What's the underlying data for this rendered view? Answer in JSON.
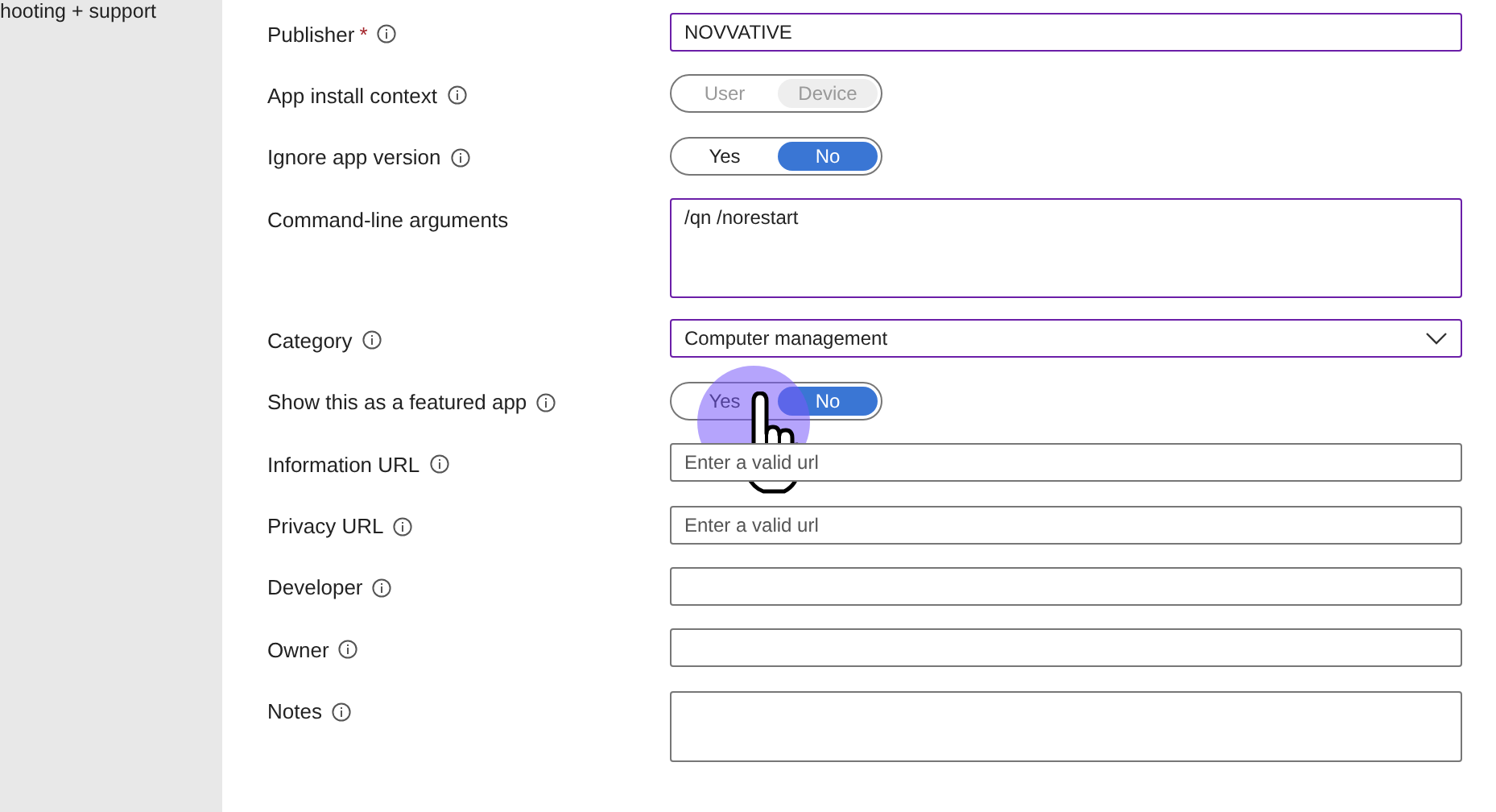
{
  "sidebar": {
    "items": [
      {
        "label": "hooting + support"
      }
    ]
  },
  "fields": [
    {
      "kind": "text",
      "label": "Publisher",
      "required_mark": "*",
      "info": true,
      "value": "NOVVATIVE",
      "focused": true
    },
    {
      "kind": "toggle",
      "label": "App install context",
      "info": true,
      "disabled": true,
      "options": [
        {
          "label": "User",
          "selected": false
        },
        {
          "label": "Device",
          "selected": true
        }
      ]
    },
    {
      "kind": "toggle",
      "label": "Ignore app version",
      "info": true,
      "disabled": false,
      "options": [
        {
          "label": "Yes",
          "selected": false
        },
        {
          "label": "No",
          "selected": true
        }
      ]
    },
    {
      "kind": "textarea",
      "label": "Command-line arguments",
      "info": false,
      "value": "/qn /norestart",
      "focused": true
    },
    {
      "kind": "dropdown",
      "label": "Category",
      "info": true,
      "value": "Computer management",
      "focused": true
    },
    {
      "kind": "toggle",
      "label": "Show this as a featured app",
      "info": true,
      "disabled": false,
      "pressed": true,
      "options": [
        {
          "label": "Yes",
          "selected": false
        },
        {
          "label": "No",
          "selected": true
        }
      ]
    },
    {
      "kind": "text",
      "label": "Information URL",
      "info": true,
      "placeholder": "Enter a valid url",
      "focused": false
    },
    {
      "kind": "text",
      "label": "Privacy URL",
      "info": true,
      "placeholder": "Enter a valid url",
      "focused": false
    },
    {
      "kind": "text",
      "label": "Developer",
      "info": true,
      "focused": false
    },
    {
      "kind": "text",
      "label": "Owner",
      "info": true,
      "focused": false
    },
    {
      "kind": "textarea",
      "label": "Notes",
      "info": true,
      "focused": false
    }
  ]
}
